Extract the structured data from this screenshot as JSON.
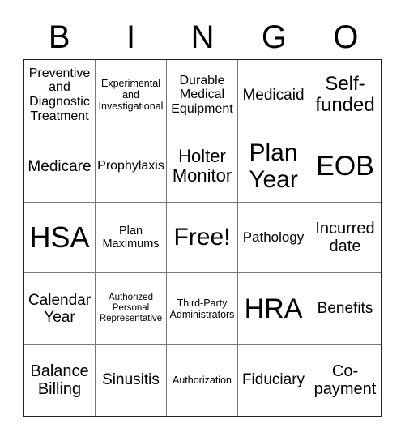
{
  "header": [
    "B",
    "I",
    "N",
    "G",
    "O"
  ],
  "cells": [
    "Preventive and Diagnostic Treatment",
    "Experimental and Investigational",
    "Durable Medical Equipment",
    "Medicaid",
    "Self-funded",
    "Medicare",
    "Prophylaxis",
    "Holter Monitor",
    "Plan Year",
    "EOB",
    "HSA",
    "Plan Maximums",
    "Free!",
    "Pathology",
    "Incurred date",
    "Calendar Year",
    "Authorized Personal Representative",
    "Third-Party Administrators",
    "HRA",
    "Benefits",
    "Balance Billing",
    "Sinusitis",
    "Authorization",
    "Fiduciary",
    "Co-payment"
  ]
}
